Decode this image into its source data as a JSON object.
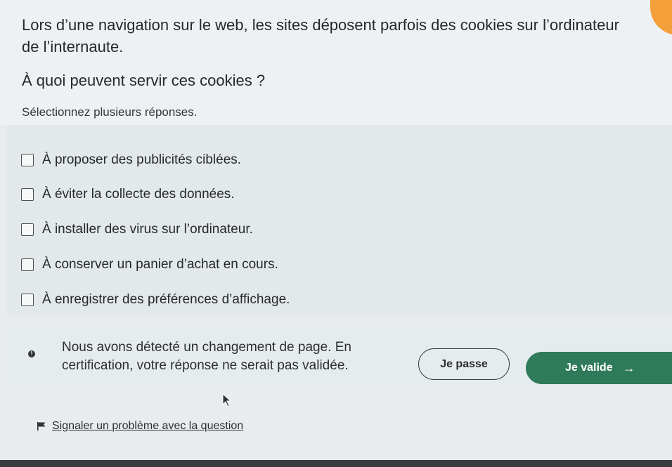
{
  "question": {
    "text": "Lors d’une navigation sur le web, les sites déposent parfois des cookies sur l’ordinateur de l’internaute.",
    "prompt": "À quoi peuvent servir ces cookies ?",
    "instruction": "Sélectionnez plusieurs réponses."
  },
  "options": [
    {
      "label": "À proposer des publicités ciblées.",
      "checked": false
    },
    {
      "label": "À éviter la collecte des données.",
      "checked": false
    },
    {
      "label": "À installer des virus sur l’ordinateur.",
      "checked": false
    },
    {
      "label": "À conserver un panier d’achat en cours.",
      "checked": false
    },
    {
      "label": "À enregistrer des préférences d’affichage.",
      "checked": false
    }
  ],
  "notice": {
    "text": "Nous avons détecté un changement de page. En certification, votre réponse ne serait pas validée.",
    "icon": "info-icon"
  },
  "actions": {
    "skip_label": "Je passe",
    "validate_label": "Je valide",
    "validate_icon": "arrow-right-icon"
  },
  "report": {
    "label": "Signaler un problème avec la question",
    "icon": "flag-icon"
  },
  "colors": {
    "accent": "#2f7a5a",
    "badge": "#f4a03a"
  }
}
